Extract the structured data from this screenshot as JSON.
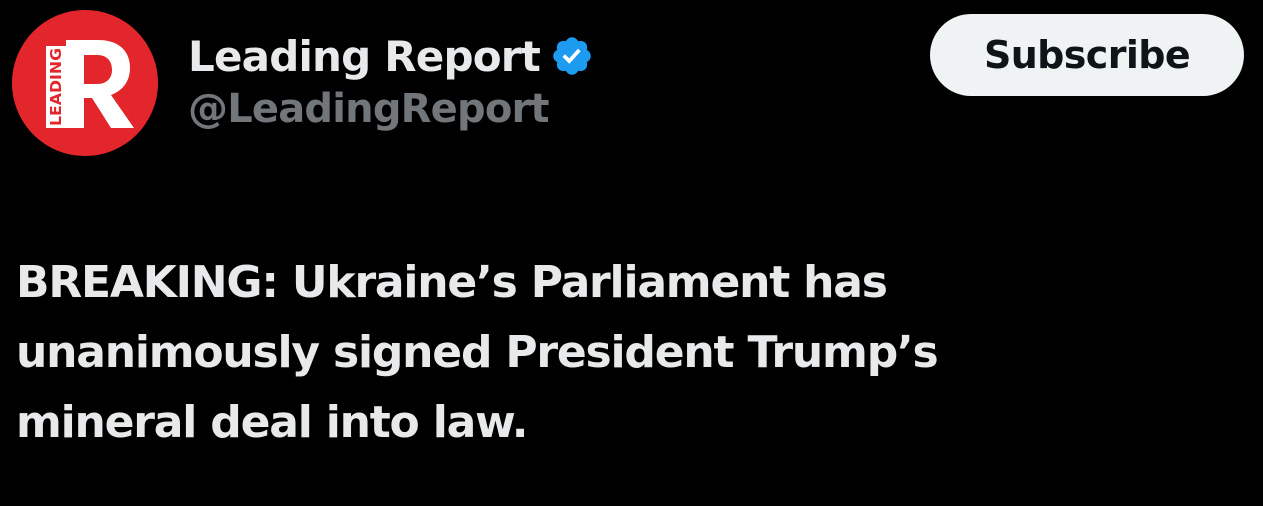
{
  "account": {
    "display_name": "Leading Report",
    "handle": "@LeadingReport",
    "verified": true,
    "avatar": {
      "icon": "leading-report-logo",
      "letter": "R",
      "vertical_text": "LEADING",
      "bg_color": "#e3262b",
      "fg_color": "#ffffff"
    }
  },
  "actions": {
    "subscribe_label": "Subscribe"
  },
  "post": {
    "text": "BREAKING: Ukraine’s Parliament has\nunanimously signed President Trump’s\nmineral deal into law."
  },
  "colors": {
    "background": "#000000",
    "primary_text": "#e7e9ea",
    "secondary_text": "#71767b",
    "verified_badge": "#1d9bf0",
    "button_bg": "#eff3f4",
    "button_text": "#0f1419"
  }
}
